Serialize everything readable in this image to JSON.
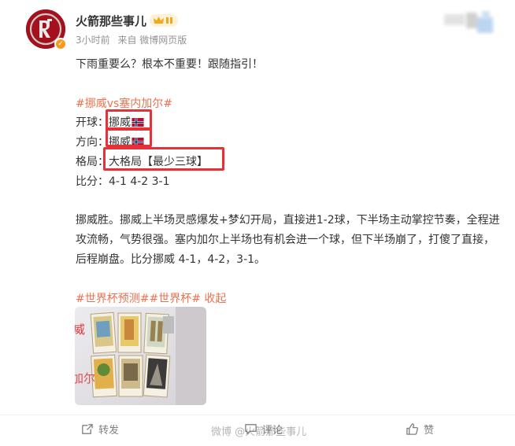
{
  "header": {
    "username": "火箭那些事儿",
    "time": "3小时前",
    "source": "来自 微博网页版",
    "avatar_text": "R"
  },
  "post": {
    "intro": "下雨重要么？根本不重要！跟随指引！",
    "topic": "#挪威vs塞内加尔#",
    "kickoff_label": "开球：",
    "kickoff_value": "挪威",
    "direction_label": "方向：",
    "direction_value": "挪威",
    "pattern_label": "格局：",
    "pattern_value": "大格局【最少三球】",
    "score_label": "比分：",
    "score_value": "4-1 4-2 3-1",
    "analysis": "挪威胜。挪威上半场灵感爆发+梦幻开局，直接进1-2球，下半场主动掌控节奏，全程进攻流畅，气势很强。塞内加尔上半场也有机会进一个球，但下半场崩了，打傻了直接，后程崩盘。比分挪威 4-1，4-2，3-1。",
    "tags": "#世界杯预测##世界杯#",
    "collapse": "收起"
  },
  "image": {
    "overlay_text_1": "威",
    "overlay_text_2": "加尔"
  },
  "footer": {
    "repost": "转发",
    "comment": "评论",
    "like": "赞",
    "watermark": "微博 @火箭那些事儿"
  },
  "colors": {
    "topic": "#eb7350",
    "highlight_box": "#e53238",
    "avatar_bg": "#a5101d",
    "badge": "#f79a1e"
  },
  "icons": [
    "crown-badge-icon",
    "verified-badge-icon",
    "norway-flag-icon",
    "repost-icon",
    "comment-icon",
    "like-icon"
  ]
}
